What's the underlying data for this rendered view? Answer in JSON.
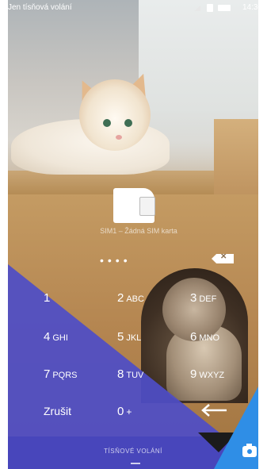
{
  "status_bar": {
    "carrier": "Jen tísňová volání",
    "time": "14:30"
  },
  "sim": {
    "message": "SIM1 – Žádná SIM karta"
  },
  "pin": {
    "dots": "••••"
  },
  "keypad": {
    "keys": [
      {
        "digit": "1",
        "letters": ""
      },
      {
        "digit": "2",
        "letters": "ABC"
      },
      {
        "digit": "3",
        "letters": "DEF"
      },
      {
        "digit": "4",
        "letters": "GHI"
      },
      {
        "digit": "5",
        "letters": "JKL"
      },
      {
        "digit": "6",
        "letters": "MNO"
      },
      {
        "digit": "7",
        "letters": "PQRS"
      },
      {
        "digit": "8",
        "letters": "TUV"
      },
      {
        "digit": "9",
        "letters": "WXYZ"
      }
    ],
    "cancel_label": "Zrušit",
    "zero": "0",
    "zero_sub": "+"
  },
  "bottom": {
    "emergency_label": "TÍSŇOVÉ VOLÁNÍ"
  },
  "colors": {
    "purple_overlay": "#4f4ec6",
    "blue_corner": "#2f8ee6"
  },
  "icons": [
    "sim-card-icon",
    "backspace-icon",
    "enter-arrow-icon",
    "camera-icon",
    "signal-icon",
    "battery-icon"
  ]
}
